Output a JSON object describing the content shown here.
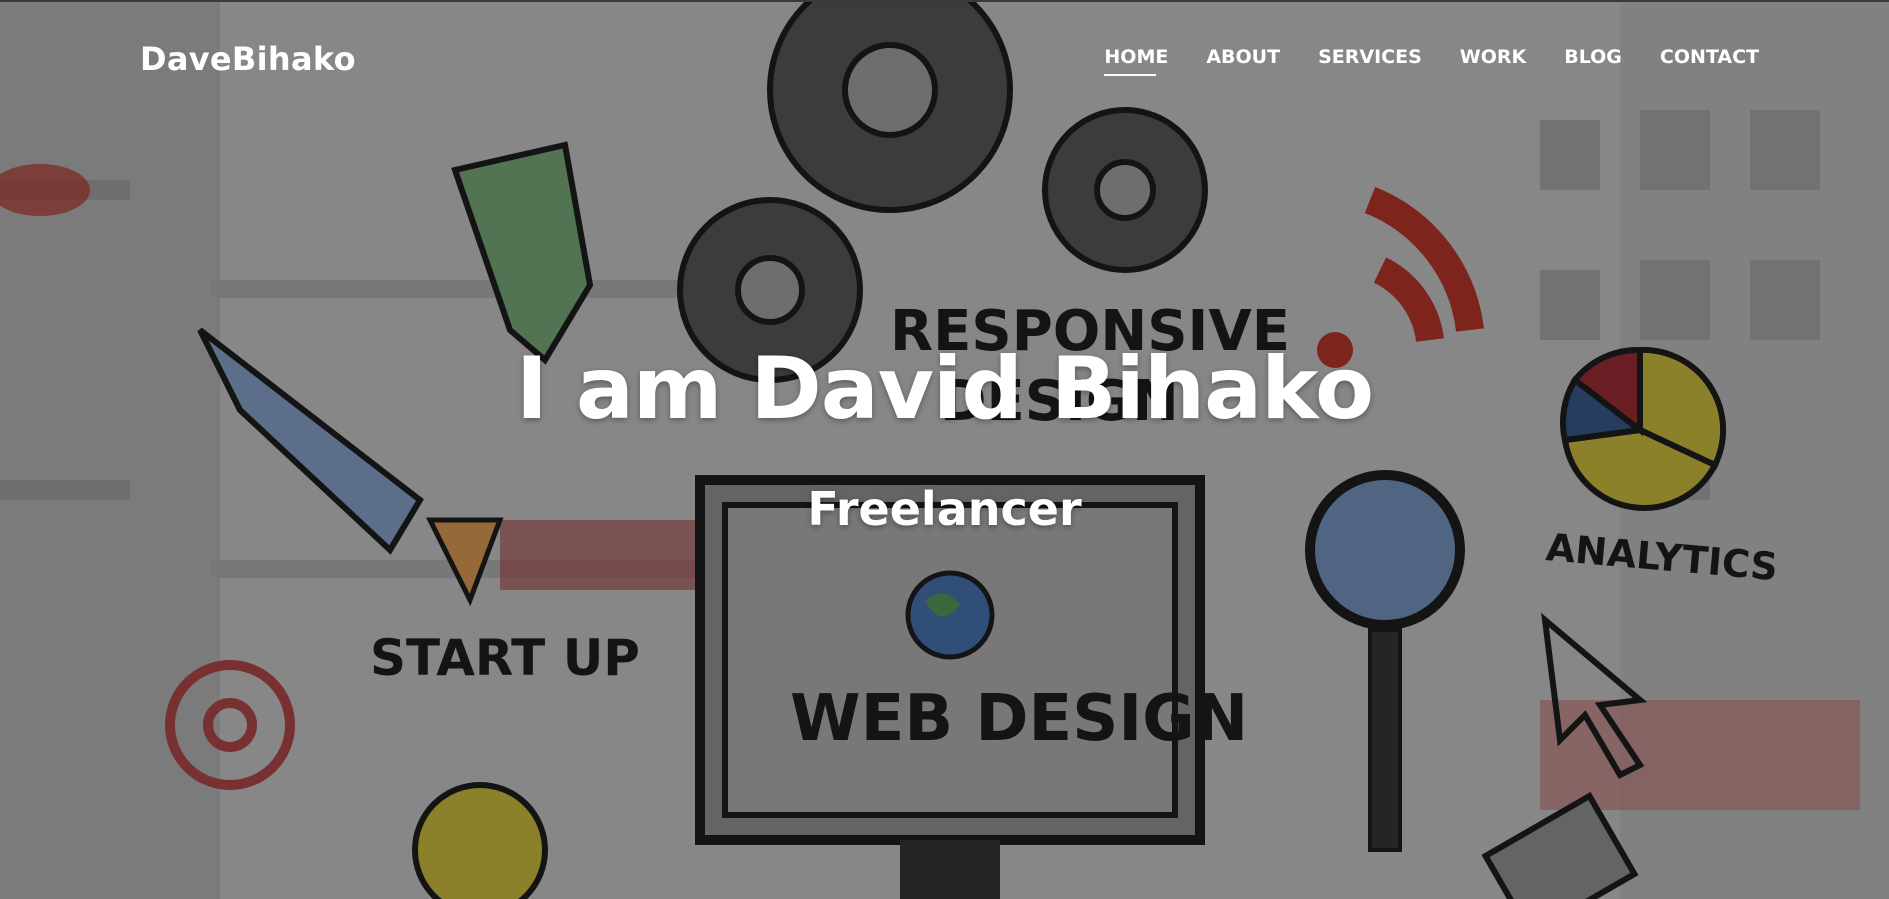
{
  "brand": "DaveBihako",
  "nav": [
    {
      "label": "HOME",
      "active": true
    },
    {
      "label": "ABOUT",
      "active": false
    },
    {
      "label": "SERVICES",
      "active": false
    },
    {
      "label": "WORK",
      "active": false
    },
    {
      "label": "BLOG",
      "active": false
    },
    {
      "label": "CONTACT",
      "active": false
    }
  ],
  "hero": {
    "title": "I am David Bihako",
    "subtitle": "Freelancer",
    "illustration": {
      "labels": [
        "RESPONSIVE",
        "DESIGN",
        "START UP",
        "WEB DESIGN",
        "ANALYTICS"
      ],
      "icons": [
        "gear-icon",
        "rocket-icon",
        "speech-bubble-icon",
        "wifi-icon",
        "pie-chart-icon",
        "magnifier-icon",
        "computer-monitor-icon",
        "globe-icon",
        "at-sign-icon",
        "light-bulb-icon",
        "cursor-arrow-icon",
        "smartphone-icon"
      ]
    }
  },
  "colors": {
    "overlay": "#000000",
    "text": "#ffffff",
    "sketch_red": "#c0392b",
    "sketch_blue": "#4a78b8",
    "sketch_yellow": "#d8c743",
    "sketch_green": "#5aa05a"
  }
}
